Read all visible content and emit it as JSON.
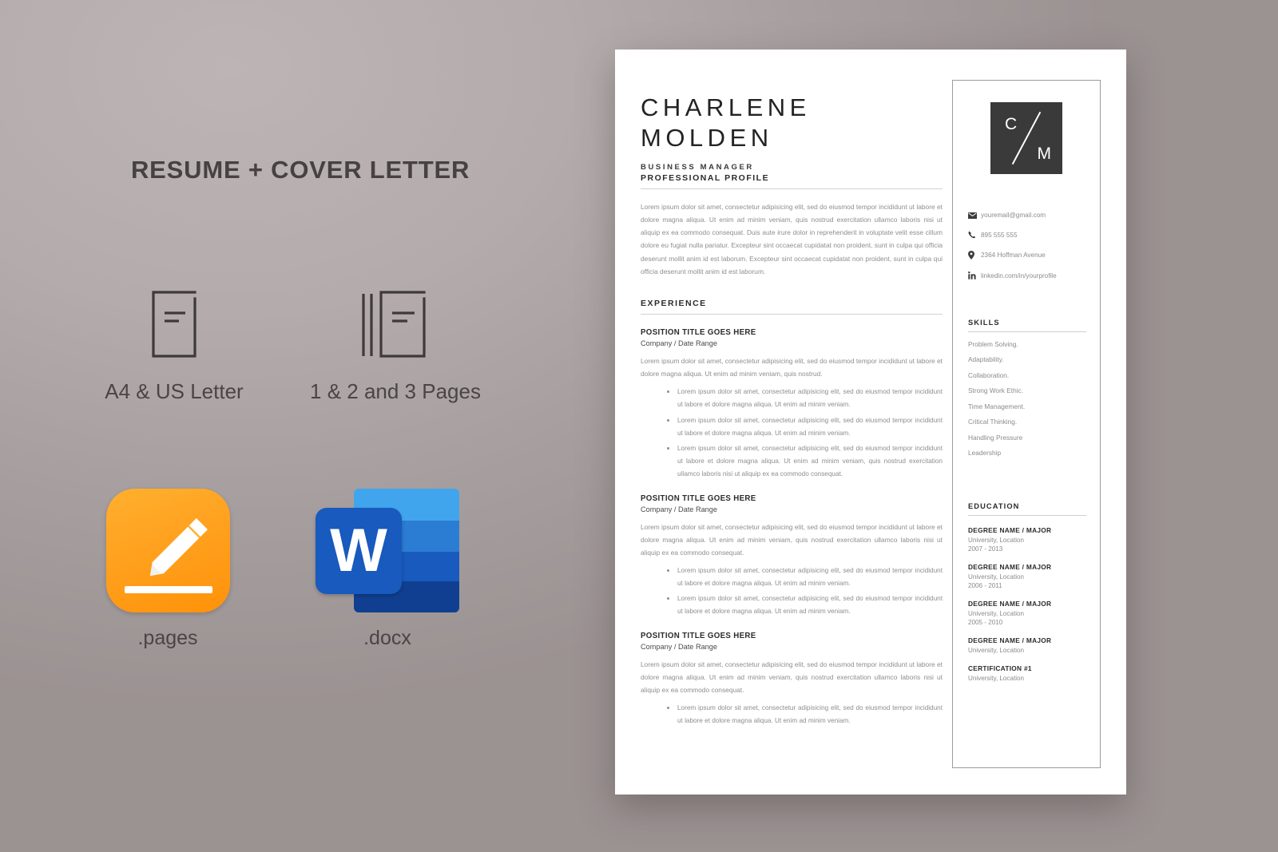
{
  "promo": {
    "title": "RESUME + COVER LETTER",
    "features": [
      {
        "icon": "single-document-icon",
        "label": "A4 & US Letter"
      },
      {
        "icon": "multiple-documents-icon",
        "label": "1 & 2 and 3 Pages"
      }
    ],
    "apps": [
      {
        "icon": "apple-pages-icon",
        "label": ".pages"
      },
      {
        "icon": "microsoft-word-icon",
        "label": ".docx",
        "glyph": "W"
      }
    ]
  },
  "resume": {
    "first_name": "CHARLENE",
    "last_name": "MOLDEN",
    "role": "BUSINESS MANAGER",
    "profile": {
      "heading": "PROFESSIONAL PROFILE",
      "text": "Lorem ipsum dolor sit amet, consectetur adipisicing elit, sed do eiusmod tempor incididunt ut labore et dolore magna aliqua. Ut enim ad minim veniam, quis nostrud exercitation ullamco laboris nisi ut aliquip ex ea commodo consequat. Duis aute irure dolor in reprehenderit in voluptate velit esse cillum dolore eu fugiat nulla pariatur. Excepteur sint occaecat cupidatat non proident, sunt in culpa qui officia deserunt mollit anim id est laborum. Excepteur sint occaecat cupidatat non proident, sunt in culpa qui officia deserunt mollit anim id est laborum."
    },
    "experience": {
      "heading": "EXPERIENCE",
      "jobs": [
        {
          "title": "POSITION TITLE GOES HERE",
          "meta": "Company / Date Range",
          "desc": "Lorem ipsum dolor sit amet, consectetur adipisicing elit, sed do eiusmod tempor incididunt ut labore et dolore magna aliqua. Ut enim ad minim veniam, quis nostrud.",
          "bullets": [
            "Lorem ipsum dolor sit amet, consectetur adipisicing elit, sed do eiusmod tempor incididunt ut labore et dolore magna aliqua. Ut enim ad minim veniam.",
            "Lorem ipsum dolor sit amet, consectetur adipisicing elit, sed do eiusmod tempor incididunt ut labore et dolore magna aliqua. Ut enim ad minim veniam.",
            "Lorem ipsum dolor sit amet, consectetur adipisicing elit, sed do eiusmod tempor incididunt ut labore et dolore magna aliqua. Ut enim ad minim veniam, quis nostrud exercitation ullamco laboris nisi ut aliquip ex ea commodo consequat."
          ]
        },
        {
          "title": "POSITION TITLE GOES HERE",
          "meta": "Company / Date Range",
          "desc": "Lorem ipsum dolor sit amet, consectetur adipisicing elit, sed do eiusmod tempor incididunt ut labore et dolore magna aliqua. Ut enim ad minim veniam, quis nostrud exercitation ullamco laboris nisi ut aliquip ex ea commodo consequat.",
          "bullets": [
            "Lorem ipsum dolor sit amet, consectetur adipisicing elit, sed do eiusmod tempor incididunt ut labore et dolore magna aliqua. Ut enim ad minim veniam.",
            "Lorem ipsum dolor sit amet, consectetur adipisicing elit, sed do eiusmod tempor incididunt ut labore et dolore magna aliqua. Ut enim ad minim veniam."
          ]
        },
        {
          "title": "POSITION TITLE GOES HERE",
          "meta": "Company / Date Range",
          "desc": "Lorem ipsum dolor sit amet, consectetur adipisicing elit, sed do eiusmod tempor incididunt ut labore et dolore magna aliqua. Ut enim ad minim veniam, quis nostrud exercitation ullamco laboris nisi ut aliquip ex ea commodo consequat.",
          "bullets": [
            "Lorem ipsum dolor sit amet, consectetur adipisicing elit, sed do eiusmod tempor incididunt ut labore et dolore magna aliqua. Ut enim ad minim veniam."
          ]
        }
      ]
    },
    "sidebar": {
      "monogram": {
        "top": "C",
        "bottom": "M"
      },
      "contacts": [
        {
          "icon": "envelope-icon",
          "text": "youremail@gmail.com"
        },
        {
          "icon": "phone-icon",
          "text": "895 555 555"
        },
        {
          "icon": "map-pin-icon",
          "text": "2364 Hoffman Avenue"
        },
        {
          "icon": "linkedin-icon",
          "text": "linkedin.com/in/yourprofile"
        }
      ],
      "skills": {
        "heading": "SKILLS",
        "items": [
          "Problem Solving.",
          "Adaptability.",
          "Collaboration.",
          "Strong Work Ethic.",
          "Time Management.",
          "Critical Thinking.",
          "Handling Pressure",
          "Leadership"
        ]
      },
      "education": {
        "heading": "EDUCATION",
        "items": [
          {
            "degree": "DEGREE NAME / MAJOR",
            "university": "University, Location",
            "years": "2007 - 2013"
          },
          {
            "degree": "DEGREE NAME / MAJOR",
            "university": "University, Location",
            "years": "2006 - 2011"
          },
          {
            "degree": "DEGREE NAME / MAJOR",
            "university": "University, Location",
            "years": "2005 - 2010"
          },
          {
            "degree": "DEGREE NAME / MAJOR",
            "university": "University, Location",
            "years": ""
          },
          {
            "degree": "CERTIFICATION #1",
            "university": "University, Location",
            "years": ""
          }
        ]
      }
    }
  }
}
